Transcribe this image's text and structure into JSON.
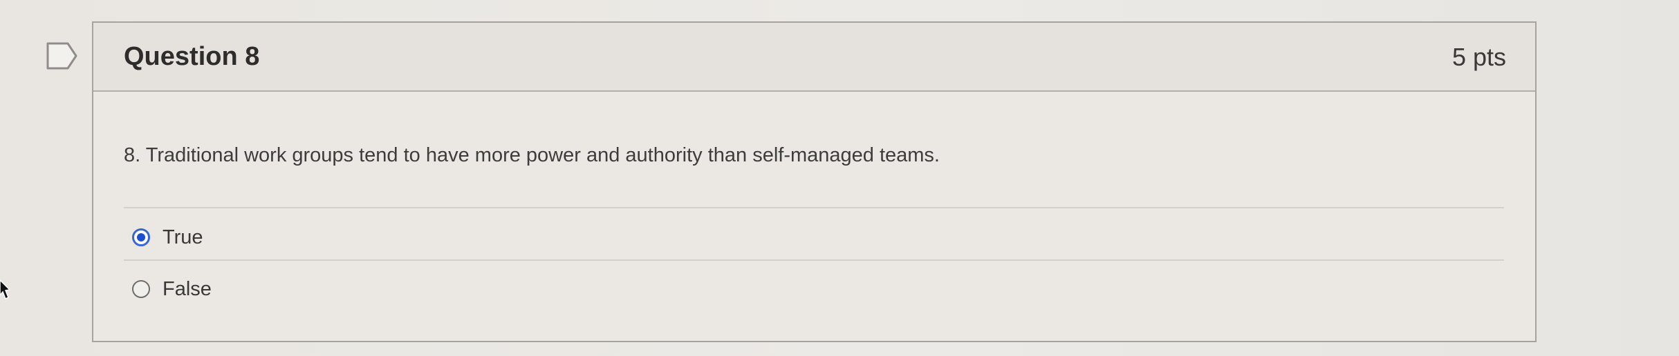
{
  "question": {
    "title": "Question 8",
    "points": "5 pts",
    "text": "8. Traditional work groups tend to have more power and authority than self-managed teams.",
    "answers": [
      {
        "label": "True",
        "selected": true
      },
      {
        "label": "False",
        "selected": false
      }
    ]
  },
  "icons": {
    "flag": "flag-bookmark-icon",
    "cursor": "mouse-pointer-icon"
  },
  "colors": {
    "selected_radio": "#1e4fd0",
    "border": "#a6a39f"
  }
}
